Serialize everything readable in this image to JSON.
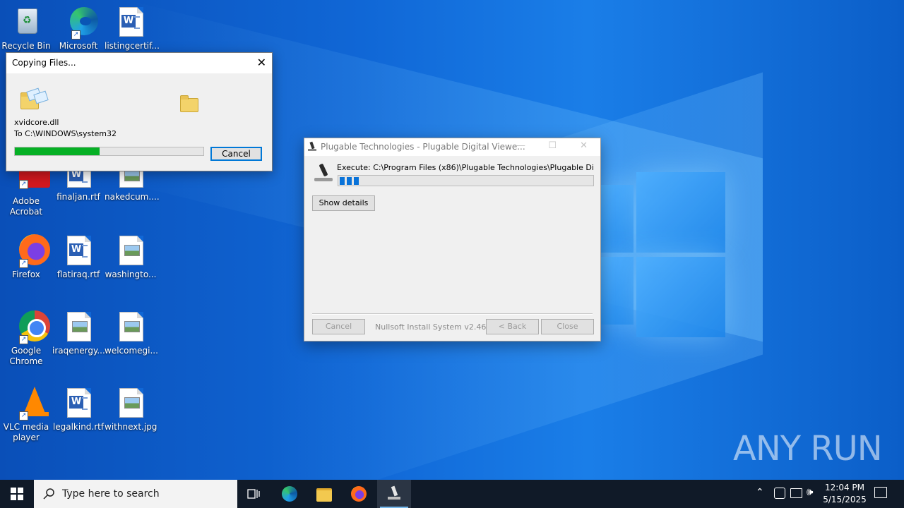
{
  "desktop": {
    "icons": [
      {
        "label": "Recycle Bin"
      },
      {
        "label": "Microsoft"
      },
      {
        "label": "listingcertif..."
      },
      {
        "label": "Adobe Acrobat"
      },
      {
        "label": "finaljan.rtf"
      },
      {
        "label": "nakedcum...."
      },
      {
        "label": "Firefox"
      },
      {
        "label": "flatiraq.rtf"
      },
      {
        "label": "washingto..."
      },
      {
        "label": "Google Chrome"
      },
      {
        "label": "iraqenergy..."
      },
      {
        "label": "welcomegi..."
      },
      {
        "label": "VLC media player"
      },
      {
        "label": "legalkind.rtf"
      },
      {
        "label": "withnext.jpg"
      }
    ]
  },
  "copy_dialog": {
    "title": "Copying Files...",
    "file_name": "xvidcore.dll",
    "destination": "To C:\\WINDOWS\\system32",
    "progress_percent": 45,
    "cancel_label": "Cancel"
  },
  "installer": {
    "title": "Plugable Technologies - Plugable Digital Viewe...",
    "status": "Execute: C:\\Program Files (x86)\\Plugable Technologies\\Plugable Digital View",
    "progress_segments": 3,
    "show_details_label": "Show details",
    "cancel_label": "Cancel",
    "branding": "Nullsoft Install System v2.46",
    "back_label": "< Back",
    "close_label": "Close"
  },
  "taskbar": {
    "search_placeholder": "Type here to search",
    "time": "12:04 PM",
    "date": "5/15/2025"
  },
  "watermark": "ANY RUN",
  "colors": {
    "copy_progress": "#06b025",
    "installer_progress": "#0a73d9",
    "taskbar_bg": "#101a28"
  }
}
